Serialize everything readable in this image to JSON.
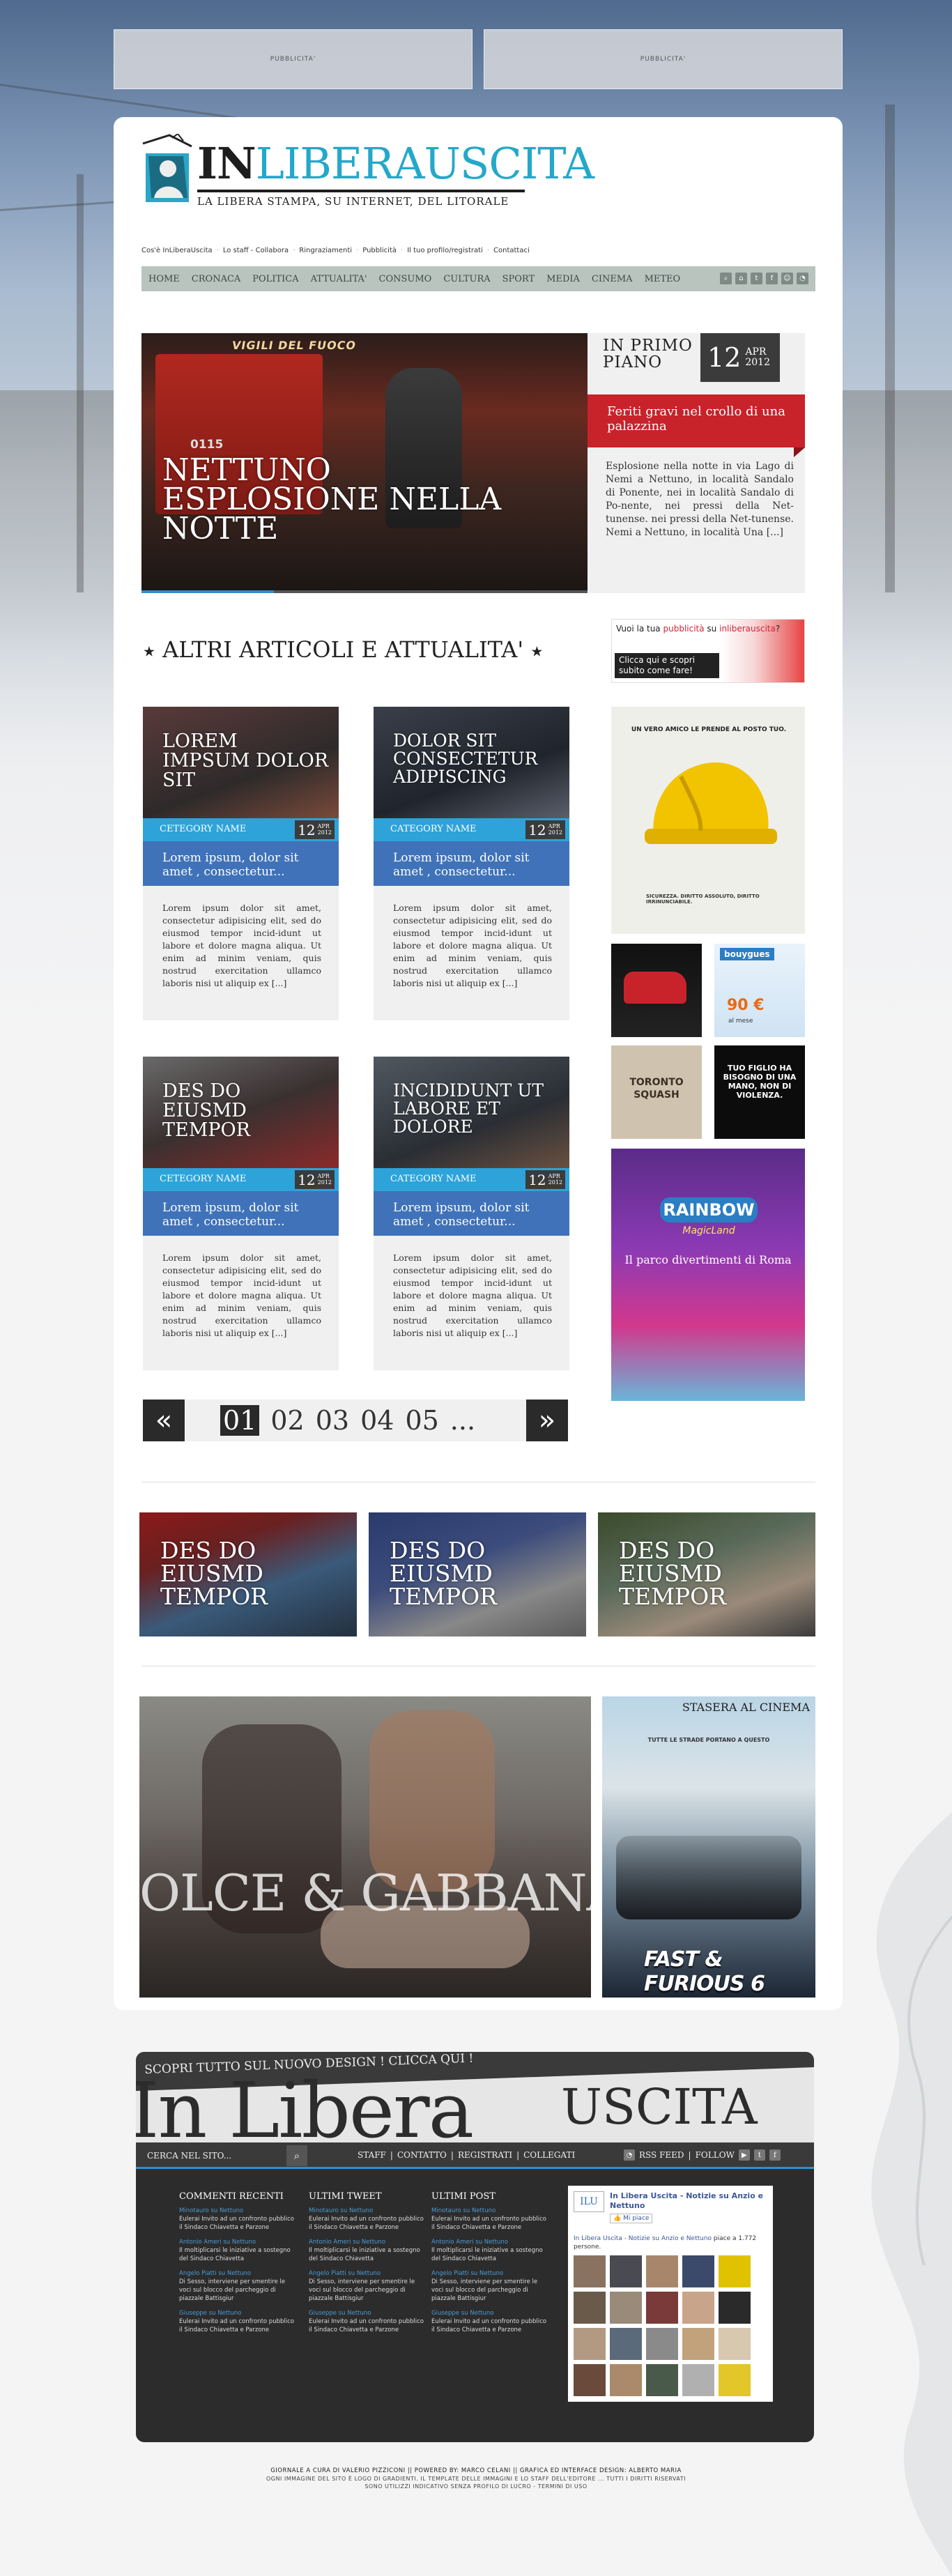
{
  "ads": {
    "top_left": "PUBBLICITA'",
    "top_right": "PUBBLICITA'"
  },
  "logo": {
    "in": "IN",
    "name": "LIBERAUSCITA",
    "tagline": "LA LIBERA STAMPA, SU INTERNET, DEL LITORALE"
  },
  "top_links": [
    "Cos'è InLiberaUscita",
    "Lo staff - Collabora",
    "Ringraziamenti",
    "Pubblicità",
    "Il tuo profilo/registrati",
    "Contattaci"
  ],
  "nav": [
    "HOME",
    "CRONACA",
    "POLITICA",
    "ATTUALITA'",
    "CONSUMO",
    "CULTURA",
    "SPORT",
    "MEDIA",
    "CINEMA",
    "METEO"
  ],
  "nav_icons": [
    "search-icon",
    "home-icon",
    "twitter-icon",
    "facebook-icon",
    "user-icon",
    "rss-icon"
  ],
  "hero": {
    "truck_text": "VIGILI DEL FUOCO",
    "truck_number": "0115",
    "title": "NETTUNO ESPLOSIONE NELLA NOTTE"
  },
  "in_primo_piano": {
    "label": "IN PRIMO PIANO",
    "day": "12",
    "month": "APR",
    "year": "2012",
    "headline": "Feriti gravi nel crollo di una palazzina",
    "text": "Esplosione nella notte in via Lago di Nemi a Nettuno, in località Sandalo di Ponente, nei in località Sandalo di Po-nente, nei pressi della Net-tunense. nei pressi della Net-tunense. Nemi a Nettuno, in località Una [...]"
  },
  "section": {
    "title": "ALTRI ARTICOLI E ATTUALITA'"
  },
  "side_ad": {
    "line1a": "Vuoi la tua ",
    "line1b": "pubblicità",
    "line1c": " su ",
    "line1d": "inliberauscita",
    "line1e": "?",
    "line2": "Clicca qui e scopri subito come fare!"
  },
  "articles": [
    {
      "title": "LOREM IMPSUM DOLOR SIT",
      "category": "CETEGORY NAME",
      "day": "12",
      "month": "APR",
      "year": "2012",
      "subtitle": "Lorem ipsum, dolor sit amet , consectetur...",
      "text": "Lorem ipsum dolor sit amet, consectetur adipisicing elit, sed do eiusmod tempor incid-idunt ut labore et dolore magna aliqua. Ut enim ad minim veniam, quis nostrud exercitation ullamco laboris nisi ut aliquip ex [...]"
    },
    {
      "title": "DOLOR SIT CONSECTETUR ADIPISCING",
      "category": "CATEGORY NAME",
      "day": "12",
      "month": "APR",
      "year": "2012",
      "subtitle": "Lorem ipsum, dolor sit amet , consectetur...",
      "text": "Lorem ipsum dolor sit amet, consectetur adipisicing elit, sed do eiusmod tempor incid-idunt ut labore et dolore magna aliqua. Ut enim ad minim veniam, quis nostrud exercitation ullamco laboris nisi ut aliquip ex [...]"
    },
    {
      "title": "DES DO EIUSMD TEMPOR",
      "category": "CETEGORY NAME",
      "day": "12",
      "month": "APR",
      "year": "2012",
      "subtitle": "Lorem ipsum, dolor sit amet , consectetur...",
      "text": "Lorem ipsum dolor sit amet, consectetur adipisicing elit, sed do eiusmod tempor incid-idunt ut labore et dolore magna aliqua. Ut enim ad minim veniam, quis nostrud exercitation ullamco laboris nisi ut aliquip ex [...]"
    },
    {
      "title": "INCIDIDUNT UT LABORE ET DOLORE",
      "category": "CATEGORY NAME",
      "day": "12",
      "month": "APR",
      "year": "2012",
      "subtitle": "Lorem ipsum, dolor sit amet , consectetur...",
      "text": "Lorem ipsum dolor sit amet, consectetur adipisicing elit, sed do eiusmod tempor incid-idunt ut labore et dolore magna aliqua. Ut enim ad minim veniam, quis nostrud exercitation ullamco laboris nisi ut aliquip ex [...]"
    }
  ],
  "right_ads": {
    "helmet_top": "UN VERO AMICO LE PRENDE AL POSTO TUO.",
    "helmet_bottom": "SICUREZZA. DIRITTO ASSOLUTO, DIRITTO IRRINUNCIABILE.",
    "bouygues": "bouygues",
    "bouygues_price": "90 €",
    "bouygues_sub": "al mese",
    "toronto": "TORONTO SQUASH",
    "violenza": "TUO FIGLIO HA BISOGNO DI UNA MANO, NON DI VIOLENZA.",
    "rainbow_title": "RAINBOW",
    "rainbow_sub": "MagicLand",
    "rainbow_text": "Il parco divertimenti di Roma"
  },
  "pagination": {
    "prev": "«",
    "next": "»",
    "pages": [
      "01",
      "02",
      "03",
      "04",
      "05",
      "..."
    ]
  },
  "features": [
    "DES DO EIUSMD TEMPOR",
    "DES DO EIUSMD TEMPOR",
    "DES DO EIUSMD TEMPOR"
  ],
  "big_image": {
    "brand": "OLCE & GABBANA"
  },
  "cinema": {
    "label": "STASERA AL CINEMA",
    "tagline": "TUTTE LE STRADE PORTANO A QUESTO",
    "movie": "FAST & FURIOUS 6"
  },
  "footer": {
    "cta": "SCOPRI TUTTO SUL NUOVO DESIGN ! CLICCA QUI !",
    "brand_a": "In Libera",
    "brand_b": "USCITA",
    "search": "CERCA NEL SITO...",
    "links": [
      "STAFF",
      "CONTATTO",
      "REGISTRATI",
      "COLLEGATI"
    ],
    "rss": "RSS FEED",
    "follow": "FOLLOW",
    "columns": [
      {
        "title": "COMMENTI RECENTI",
        "items": [
          {
            "author": "Minotauro su Nettuno",
            "text": "Eulerai Invito ad un confronto pubblico il Sindaco Chiavetta e Parzone"
          },
          {
            "author": "Antonio Ameri su Nettuno",
            "text": "Il moltiplicarsi le iniziative a sostegno del Sindaco Chiavetta"
          },
          {
            "author": "Angelo Piatti su Nettuno",
            "text": "Di Sesso, interviene per smentire le voci sul blocco del parcheggio di piazzale Battisgiur"
          },
          {
            "author": "Giuseppe su Nettuno",
            "text": "Eulerai Invito ad un confronto pubblico il Sindaco Chiavetta e Parzone"
          }
        ]
      },
      {
        "title": "ULTIMI TWEET",
        "items": [
          {
            "author": "Minotauro su Nettuno",
            "text": "Eulerai Invito ad un confronto pubblico il Sindaco Chiavetta e Parzone"
          },
          {
            "author": "Antonio Ameri su Nettuno",
            "text": "Il moltiplicarsi le iniziative a sostegno del Sindaco Chiavetta"
          },
          {
            "author": "Angelo Piatti su Nettuno",
            "text": "Di Sesso, interviene per smentire le voci sul blocco del parcheggio di piazzale Battisgiur"
          },
          {
            "author": "Giuseppe su Nettuno",
            "text": "Eulerai Invito ad un confronto pubblico il Sindaco Chiavetta e Parzone"
          }
        ]
      },
      {
        "title": "ULTIMI POST",
        "items": [
          {
            "author": "Minotauro su Nettuno",
            "text": "Eulerai Invito ad un confronto pubblico il Sindaco Chiavetta e Parzone"
          },
          {
            "author": "Antonio Ameri su Nettuno",
            "text": "Il moltiplicarsi le iniziative a sostegno del Sindaco Chiavetta"
          },
          {
            "author": "Angelo Piatti su Nettuno",
            "text": "Di Sesso, interviene per smentire le voci sul blocco del parcheggio di piazzale Battisgiur"
          },
          {
            "author": "Giuseppe su Nettuno",
            "text": "Eulerai Invito ad un confronto pubblico il Sindaco Chiavetta e Parzone"
          }
        ]
      }
    ],
    "fb": {
      "logo": "ILU",
      "name": "In Libera Uscita - Notizie su Anzio e Nettuno",
      "like": "Mi piace",
      "desc_a": "In Libera Uscita - Notizie su Anzio e Nettuno",
      "desc_b": " piace a 1.772 persone."
    }
  },
  "credits": {
    "line1": "GIORNALE A CURA DI VALERIO PIZZICONI || POWERED BY: MARCO CELANI || GRAFICA ED INTERFACE DESIGN: ALBERTO MARIA",
    "line2": "OGNI IMMAGINE DEL SITO È LOGO DI GRADIENTI. IL TEMPLATE DELLE IMMAGINI E LO STAFF DELL'EDITORE ... TUTTI I DIRITTI RISERVATI",
    "line3": "SONO UTILIZZI INDICATIVO SENZA PROFILO DI LUCRO - TERMINI DI USO"
  }
}
